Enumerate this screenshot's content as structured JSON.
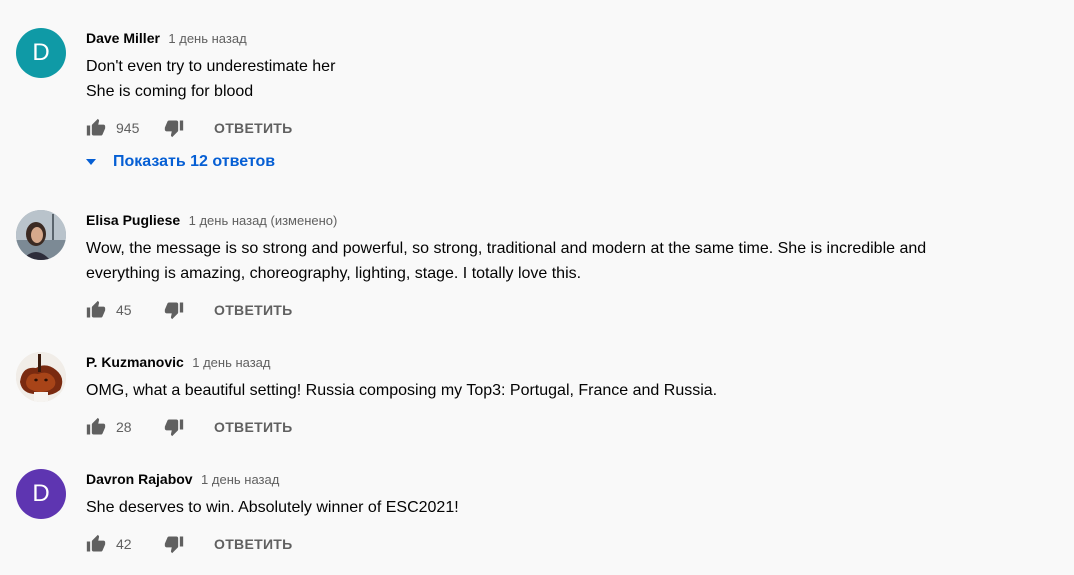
{
  "comments": [
    {
      "author": "Dave Miller",
      "time": "1 день назад",
      "avatar_letter": "D",
      "avatar_color": "#0f9aa6",
      "lines": [
        "Don't even try to underestimate her",
        "She is coming for blood"
      ],
      "likes": "945",
      "reply_label": "ОТВЕТИТЬ",
      "show_replies": "Показать 12 ответов"
    },
    {
      "author": "Elisa Pugliese",
      "time": "1 день назад (изменено)",
      "avatar_icon": "photo-avatar",
      "lines": [
        "Wow, the message is so strong and powerful, so strong, traditional and modern at the same time. She is incredible and",
        "everything is amazing, choreography, lighting, stage. I totally love this."
      ],
      "likes": "45",
      "reply_label": "ОТВЕТИТЬ"
    },
    {
      "author": "P. Kuzmanovic",
      "time": "1 день назад",
      "avatar_icon": "violin-avatar",
      "lines": [
        "OMG, what a beautiful setting! Russia composing my Top3: Portugal, France and Russia."
      ],
      "likes": "28",
      "reply_label": "ОТВЕТИТЬ"
    },
    {
      "author": "Davron Rajabov",
      "time": "1 день назад",
      "avatar_letter": "D",
      "avatar_color": "#5e35b1",
      "lines": [
        "She deserves to win. Absolutely winner of ESC2021!"
      ],
      "likes": "42",
      "reply_label": "ОТВЕТИТЬ"
    }
  ],
  "colors": {
    "link_blue": "#065fd4",
    "secondary_text": "#606060",
    "background": "#f9f9f9"
  }
}
